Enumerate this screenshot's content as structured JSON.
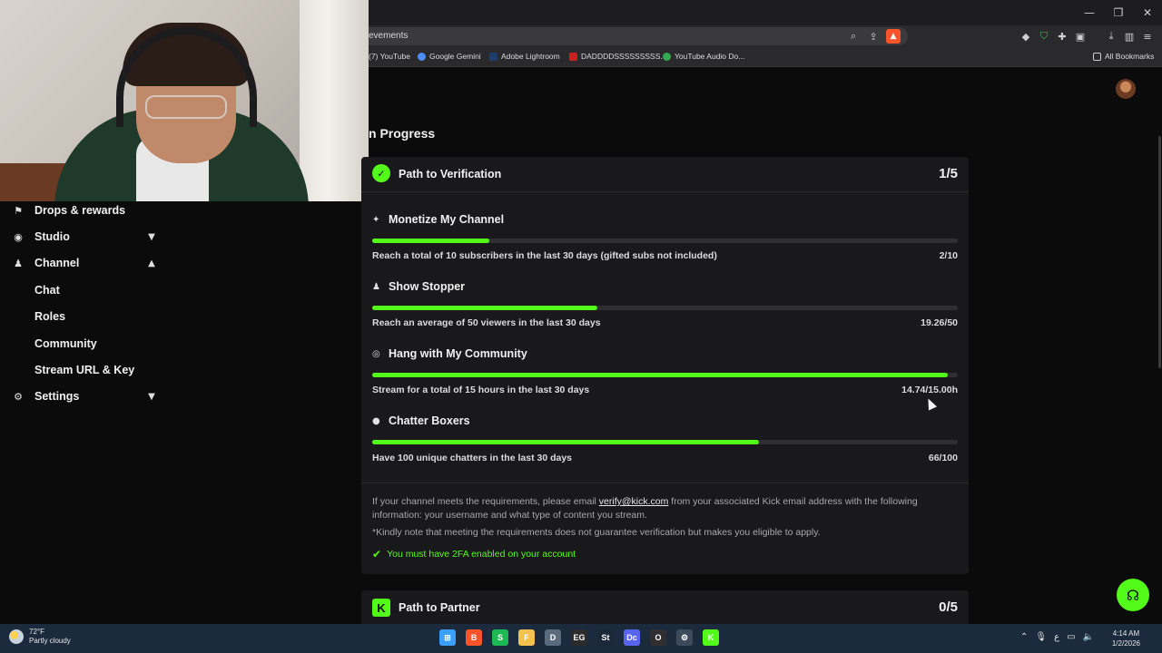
{
  "browser": {
    "url_fragment": "evements",
    "window_controls": [
      "—",
      "❐",
      "✕"
    ],
    "bookmarks": [
      {
        "label": "(7) YouTube",
        "color": "#ff0000"
      },
      {
        "label": "Google Gemini",
        "color": "#4d8bf5"
      },
      {
        "label": "Adobe Lightroom",
        "color": "#1c3d6e"
      },
      {
        "label": "DADDDDSSSSSSSSS...",
        "color": "#cc1f1f"
      },
      {
        "label": "YouTube Audio Do...",
        "color": "#34a853"
      }
    ],
    "all_bookmarks": "All Bookmarks"
  },
  "sidebar": {
    "items": [
      {
        "label": "Drops & rewards",
        "icon": "gift-icon"
      },
      {
        "label": "Studio",
        "icon": "camera-icon",
        "chevron": "down"
      },
      {
        "label": "Channel",
        "icon": "users-icon",
        "chevron": "up"
      },
      {
        "label": "Settings",
        "icon": "gear-icon",
        "chevron": "down"
      }
    ],
    "channel_sub": [
      "Chat",
      "Roles",
      "Community",
      "Stream URL & Key"
    ]
  },
  "main": {
    "section_title": "n Progress",
    "verification": {
      "title": "Path to Verification",
      "count": "1/5",
      "goals": [
        {
          "title": "Monetize My Channel",
          "icon": "sparkle-icon",
          "desc": "Reach a total of 10 subscribers in the last 30 days (gifted subs not included)",
          "value": "2/10",
          "progress": 0.2
        },
        {
          "title": "Show Stopper",
          "icon": "viewers-icon",
          "desc": "Reach an average of 50 viewers in the last 30 days",
          "value": "19.26/50",
          "progress": 0.385
        },
        {
          "title": "Hang with My Community",
          "icon": "broadcast-icon",
          "desc": "Stream for a total of 15 hours in the last 30 days",
          "value": "14.74/15.00h",
          "progress": 0.983
        },
        {
          "title": "Chatter Boxers",
          "icon": "chat-bubble-icon",
          "desc": "Have 100 unique chatters in the last 30 days",
          "value": "66/100",
          "progress": 0.66
        }
      ],
      "info_before": "If your channel meets the requirements, please email ",
      "info_email": "verify@kick.com",
      "info_after": " from your associated Kick email address with the following information: your username and what type of content you stream.",
      "note": "*Kindly note that meeting the requirements does not guarantee verification but makes you eligible to apply.",
      "twofa": "You must have 2FA enabled on your account"
    },
    "partner": {
      "title": "Path to Partner",
      "count": "0/5",
      "badge": "K"
    }
  },
  "taskbar": {
    "temperature": "72°F",
    "weather": "Partly cloudy",
    "time": "4:14 AM",
    "date": "1/2/2026",
    "apps": [
      {
        "name": "windows-start-icon",
        "color": "#3aa0ff",
        "glyph": "⊞"
      },
      {
        "name": "brave-icon",
        "color": "#fb542b",
        "glyph": "B"
      },
      {
        "name": "spotify-icon",
        "color": "#1db954",
        "glyph": "S"
      },
      {
        "name": "file-explorer-icon",
        "color": "#f2c14e",
        "glyph": "F"
      },
      {
        "name": "davinci-icon",
        "color": "#5a6b7d",
        "glyph": "D"
      },
      {
        "name": "epic-games-icon",
        "color": "#2b2b2b",
        "glyph": "EG"
      },
      {
        "name": "steam-icon",
        "color": "#1b2838",
        "glyph": "St"
      },
      {
        "name": "discord-icon",
        "color": "#5865f2",
        "glyph": "Dc"
      },
      {
        "name": "obs-icon",
        "color": "#302e31",
        "glyph": "O"
      },
      {
        "name": "settings-app-icon",
        "color": "#3c4a5c",
        "glyph": "⚙"
      },
      {
        "name": "kick-app-icon",
        "color": "#53fc18",
        "glyph": "K"
      }
    ]
  },
  "colors": {
    "accent": "#53fc18",
    "card": "#19191b",
    "background": "#0b0b0c"
  }
}
